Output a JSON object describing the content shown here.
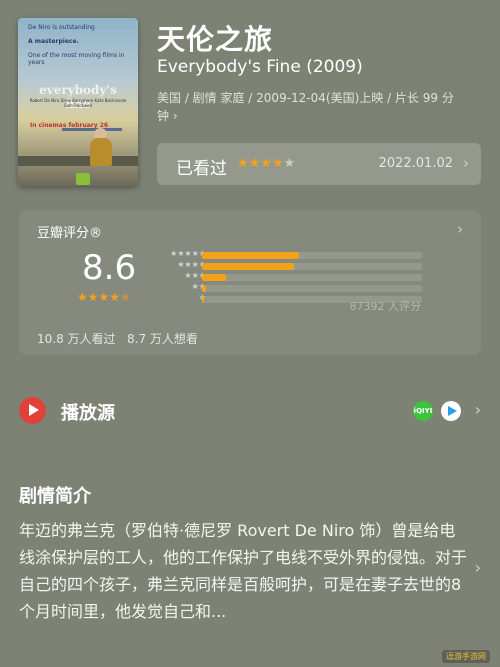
{
  "movie": {
    "title": "天伦之旅",
    "original_title": "Everybody's Fine (2009)",
    "meta": "美国 / 剧情 家庭 / 2009-12-04(美国)上映 / 片长 99 分钟 ›",
    "poster": {
      "quote_1": "De Niro is outstanding",
      "quote_2": "A masterpiece.",
      "quote_3": "One of the most moving films in years",
      "title": "everybody's fine",
      "cast": "Robert De Niro  Drew Barrymore  Kate Beckinsale  Sam Rockwell",
      "release": "In cinemas february 26"
    }
  },
  "watched": {
    "label": "已看过",
    "stars": "★★★★",
    "stars_empty": "★",
    "date": "2022.01.02",
    "chevron": "›"
  },
  "rating": {
    "label": "豆瓣评分®",
    "score": "8.6",
    "stars_full": "★★★★",
    "stars_half": "★",
    "count": "87392 人评分",
    "watched_count": "10.8 万人看过",
    "want_count": "8.7 万人想看",
    "chevron": "›",
    "distribution": [
      {
        "stars": "★★★★★",
        "percent": 44
      },
      {
        "stars": "★★★★",
        "percent": 42
      },
      {
        "stars": "★★★",
        "percent": 11
      },
      {
        "stars": "★★",
        "percent": 2
      },
      {
        "stars": "★",
        "percent": 1
      }
    ]
  },
  "play_source": {
    "label": "播放源",
    "iqiyi_text": "iQIYI",
    "icons": [
      "play-icon",
      "iqiyi-icon",
      "google-play-icon"
    ],
    "chevron": "›"
  },
  "synopsis": {
    "heading": "剧情简介",
    "text": "年迈的弗兰克（罗伯特·德尼罗 Rovert De Niro 饰）曾是给电线涂保护层的工人，他的工作保护了电线不受外界的侵蚀。对于自己的四个孩子，弗兰克同样是百般呵护，可是在妻子去世的8个月时间里，他发觉自己和...",
    "chevron": "›"
  },
  "watermark": "逗游手游网",
  "colors": {
    "background": "#7d8275",
    "star": "#f2a31a",
    "play": "#e2413a",
    "iqiyi": "#3cc43c"
  }
}
